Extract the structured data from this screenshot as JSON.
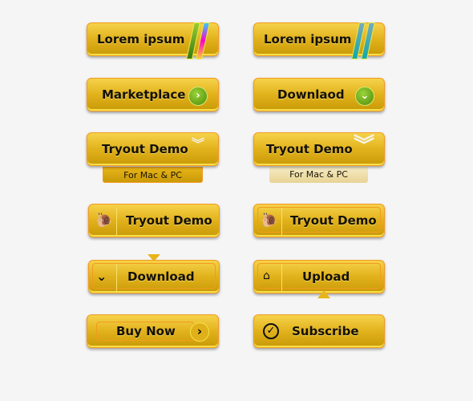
{
  "buttons": {
    "lorem1": "Lorem ipsum",
    "lorem2": "Lorem ipsum",
    "marketplace": "Marketplace",
    "download_alt": "Downlaod",
    "tryout1": "Tryout Demo",
    "tryout2": "Tryout Demo",
    "tryout1_sub": "For Mac & PC",
    "tryout2_sub": "For Mac & PC",
    "tryout3": "Tryout Demo",
    "tryout4": "Tryout Demo",
    "download": "Download",
    "upload": "Upload",
    "buy_now": "Buy Now",
    "subscribe": "Subscribe"
  },
  "colors": {
    "button_top": "#f6d24a",
    "button_bottom": "#c99a08",
    "border": "#f39a1e",
    "icon_green": "#4d8a08"
  },
  "icons": [
    "color-stripes",
    "arrow-right-circle",
    "chevron-down-circle",
    "double-chevron-down",
    "snail",
    "chevron-down",
    "home",
    "arrow-right",
    "checkmark-circle"
  ]
}
